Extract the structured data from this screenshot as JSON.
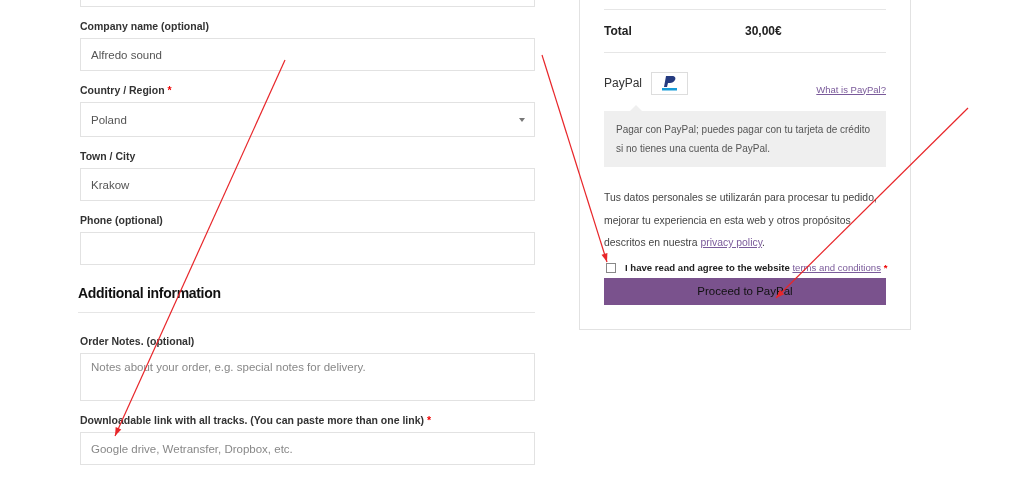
{
  "billing_fields": [
    {
      "kind": "input"
    },
    {
      "kind": "input",
      "label": "Company name (optional)",
      "value": "Alfredo sound"
    },
    {
      "kind": "select",
      "label": "Country / Region",
      "required_mark": "*",
      "value": "Poland"
    },
    {
      "kind": "input",
      "label": "Town / City",
      "value": "Krakow"
    },
    {
      "kind": "input",
      "label": "Phone (optional)"
    }
  ],
  "additional": {
    "heading": "Additional information",
    "fields": [
      {
        "kind": "textarea",
        "label": "Order Notes. (optional)",
        "placeholder": "Notes about your order, e.g. special notes for delivery."
      },
      {
        "kind": "input",
        "label": "Downloadable link with all tracks. (You can paste more than one link)",
        "required_mark": "*",
        "placeholder": "Google drive, Wetransfer, Dropbox, etc."
      }
    ]
  },
  "order": {
    "total_label": "Total",
    "total_value": "30,00€",
    "payment": {
      "name": "PayPal",
      "help_link": "What is PayPal?",
      "description": "Pagar con PayPal; puedes pagar con tu tarjeta de crédito si no tienes una cuenta de PayPal."
    },
    "privacy_text": "Tus datos personales se utilizarán para procesar tu pedido, mejorar tu experiencia en esta web y otros propósitos descritos en nuestra ",
    "privacy_link": "privacy policy",
    "privacy_end": ".",
    "terms": {
      "text": "I have read and agree to the website ",
      "link": "terms and conditions",
      "required_mark": "*",
      "checked": false
    },
    "button": "Proceed to PayPal"
  }
}
